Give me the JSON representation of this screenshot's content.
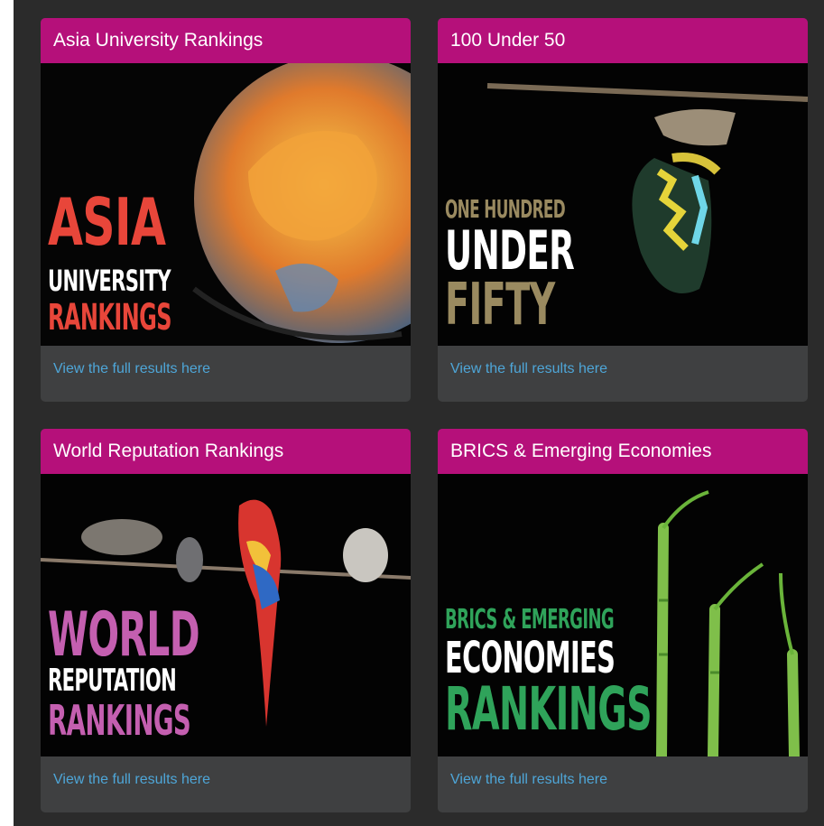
{
  "cards": [
    {
      "title": "Asia University Rankings",
      "link": "View the full results here",
      "art_lines": [
        "ASIA",
        "UNIVERSITY",
        "RANKINGS"
      ],
      "colors": {
        "primary": "#e8463a",
        "secondary": "#ffffff"
      }
    },
    {
      "title": "100 Under 50",
      "link": "View the full results here",
      "art_lines": [
        "ONE HUNDRED",
        "UNDER",
        "FIFTY"
      ],
      "colors": {
        "primary": "#9a8a60",
        "secondary": "#ffffff"
      }
    },
    {
      "title": "World Reputation Rankings",
      "link": "View the full results here",
      "art_lines": [
        "WORLD",
        "REPUTATION",
        "RANKINGS"
      ],
      "colors": {
        "primary": "#c45fb0",
        "secondary": "#ffffff"
      }
    },
    {
      "title": "BRICS & Emerging Economies",
      "link": "View the full results here",
      "art_lines": [
        "BRICS & EMERGING",
        "ECONOMIES",
        "RANKINGS"
      ],
      "colors": {
        "primary": "#2fa35a",
        "secondary": "#ffffff"
      }
    }
  ],
  "theme": {
    "header": "#b5107a",
    "card": "#3f4041",
    "link": "#4ea6d8",
    "background": "#2b2b2b"
  }
}
